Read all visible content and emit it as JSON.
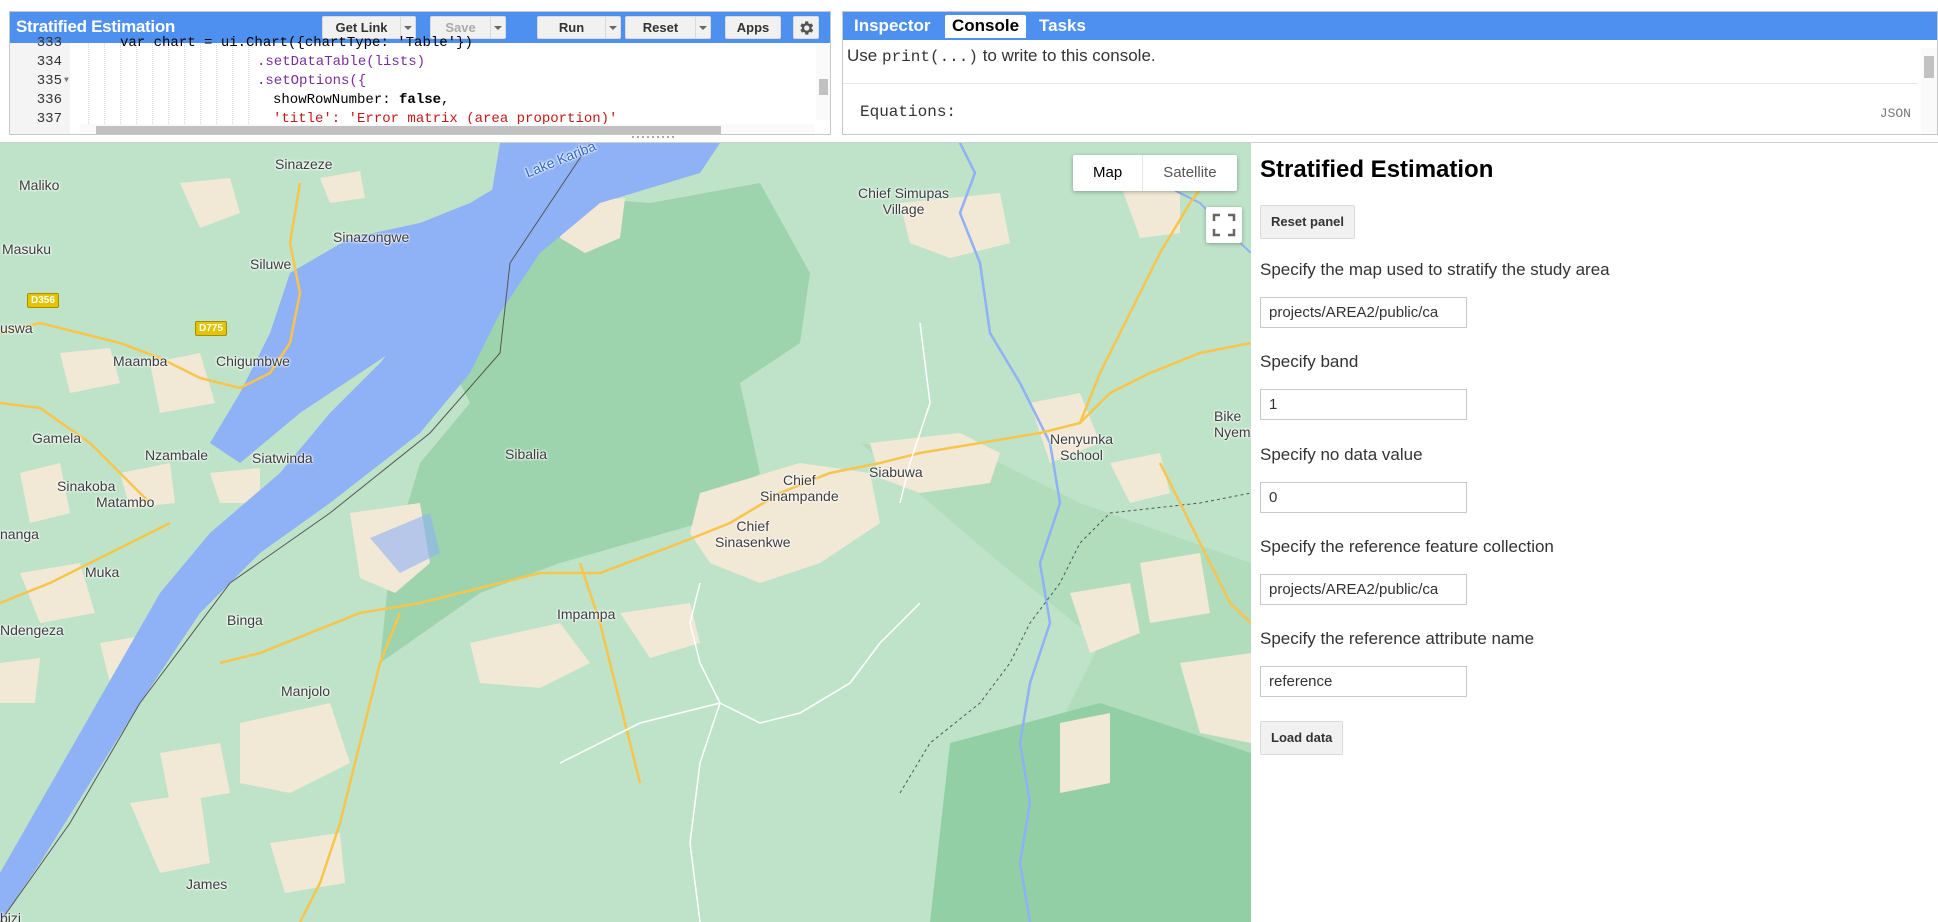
{
  "editor": {
    "title": "Stratified Estimation",
    "buttons": {
      "get_link": "Get Link",
      "save": "Save",
      "run": "Run",
      "reset": "Reset",
      "apps": "Apps"
    },
    "line_numbers": [
      "333",
      "334",
      "335",
      "336",
      "337"
    ],
    "lines": {
      "l333": "var chart = ui.Chart({chartType: 'Table'})",
      "l334": ".setDataTable(lists)",
      "l335": ".setOptions({",
      "l336a": "showRowNumber: ",
      "l336b": "false",
      "l336c": ",",
      "l337": "'title': 'Error matrix (area proportion)'"
    }
  },
  "console": {
    "tabs": [
      "Inspector",
      "Console",
      "Tasks"
    ],
    "active_tab": "Console",
    "help_pre": "Use ",
    "help_code": "print(...)",
    "help_post": " to write to this console.",
    "equations_label": "Equations:",
    "json_label": "JSON"
  },
  "map": {
    "map_type_options": [
      "Map",
      "Satellite"
    ],
    "selected_map_type": "Map",
    "labels": {
      "sinazeze": "Sinazeze",
      "lake": "Lake Kariba",
      "maliko": "Maliko",
      "sinazongwe": "Sinazongwe",
      "masuku": "Masuku",
      "siluwe": "Siluwe",
      "d356": "D356",
      "d775": "D775",
      "uswa": "uswa",
      "maamba": "Maamba",
      "chigumbwe": "Chigumbwe",
      "gamela": "Gamela",
      "nzambale": "Nzambale",
      "siatwinda": "Siatwinda",
      "sibalia": "Sibalia",
      "sinakoba": "Sinakoba",
      "matambo": "Matambo",
      "nanga": "nanga",
      "muka": "Muka",
      "ndengeza": "Ndengeza",
      "binga": "Binga",
      "manjolo": "Manjolo",
      "james": "James",
      "bizi": "bizi",
      "impampa": "Impampa",
      "chief_sinampande_1": "Chief",
      "chief_sinampande_2": "Sinampande",
      "chief_sinasenkwe_1": "Chief",
      "chief_sinasenkwe_2": "Sinasenkwe",
      "siabuwa": "Siabuwa",
      "chief_simupas_1": "Chief Simupas",
      "chief_simupas_2": "Village",
      "nenyunka_1": "Nenyunka",
      "nenyunka_2": "School",
      "bike_1": "Bike",
      "bike_2": "Nyem"
    }
  },
  "panel": {
    "title": "Stratified Estimation",
    "reset_button": "Reset panel",
    "map_label": "Specify the map used to stratify the study area",
    "map_value": "projects/AREA2/public/ca",
    "band_label": "Specify band",
    "band_value": "1",
    "nodata_label": "Specify no data value",
    "nodata_value": "0",
    "ref_fc_label": "Specify the reference feature collection",
    "ref_fc_value": "projects/AREA2/public/ca",
    "ref_attr_label": "Specify the reference attribute name",
    "ref_attr_value": "reference",
    "load_button": "Load data"
  },
  "colors": {
    "accent": "#4d90f0",
    "land": "#bfe3c9",
    "park": "#9dd4ad",
    "water": "#8fb1f5",
    "settlement": "#f2e8d6",
    "road": "#f7c54b"
  }
}
